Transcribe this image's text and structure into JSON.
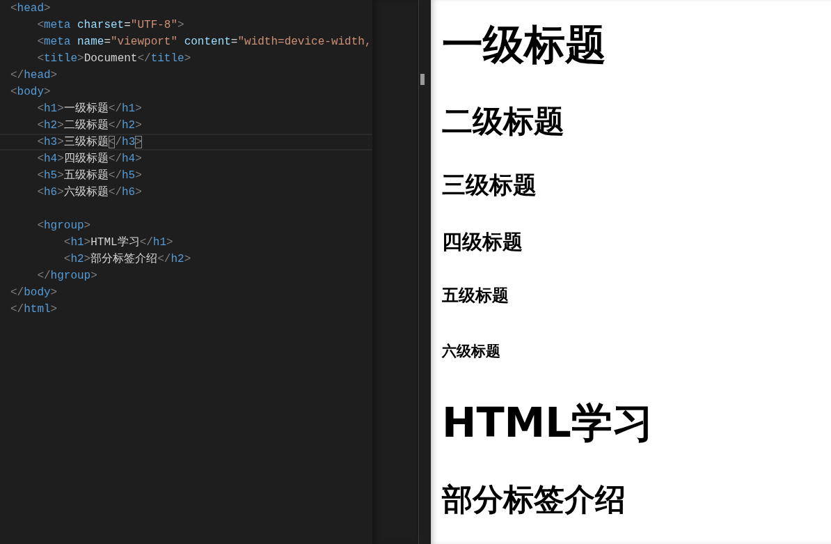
{
  "editor": {
    "lines": [
      {
        "selected": false,
        "tokens": [
          {
            "kind": "bracket",
            "text": "<"
          },
          {
            "kind": "tag",
            "text": "head"
          },
          {
            "kind": "bracket",
            "text": ">"
          }
        ],
        "children": [
          {
            "selected": false,
            "tokens": [
              {
                "kind": "bracket",
                "text": "<"
              },
              {
                "kind": "tag",
                "text": "meta"
              },
              {
                "kind": "attr",
                "text": "charset"
              },
              {
                "kind": "text",
                "text": "="
              },
              {
                "kind": "string",
                "text": "\"UTF-8\""
              },
              {
                "kind": "bracket",
                "text": ">"
              }
            ]
          },
          {
            "selected": false,
            "tokens": [
              {
                "kind": "bracket",
                "text": "<"
              },
              {
                "kind": "tag",
                "text": "meta"
              },
              {
                "kind": "attr",
                "text": "name"
              },
              {
                "kind": "text",
                "text": "="
              },
              {
                "kind": "string",
                "text": "\"viewport\""
              },
              {
                "kind": "attr",
                "text": "content"
              },
              {
                "kind": "text",
                "text": "="
              },
              {
                "kind": "string",
                "text": "\"width=device-width,"
              }
            ]
          },
          {
            "selected": false,
            "tokens": [
              {
                "kind": "bracket",
                "text": "<"
              },
              {
                "kind": "tag",
                "text": "title"
              },
              {
                "kind": "bracket",
                "text": ">"
              },
              {
                "kind": "text",
                "text": "Document"
              },
              {
                "kind": "bracket",
                "text": "</"
              },
              {
                "kind": "tag",
                "text": "title"
              },
              {
                "kind": "bracket",
                "text": ">"
              }
            ]
          }
        ]
      },
      {
        "selected": false,
        "tokens": [
          {
            "kind": "bracket",
            "text": "</"
          },
          {
            "kind": "tag",
            "text": "head"
          },
          {
            "kind": "bracket",
            "text": ">"
          }
        ]
      },
      {
        "selected": false,
        "tokens": [
          {
            "kind": "bracket",
            "text": "<"
          },
          {
            "kind": "tag",
            "text": "body"
          },
          {
            "kind": "bracket",
            "text": ">"
          }
        ],
        "children": [
          {
            "selected": false,
            "tokens": [
              {
                "kind": "bracket",
                "text": "<"
              },
              {
                "kind": "tag",
                "text": "h1"
              },
              {
                "kind": "bracket",
                "text": ">"
              },
              {
                "kind": "text",
                "text": "一级标题"
              },
              {
                "kind": "bracket",
                "text": "</"
              },
              {
                "kind": "tag",
                "text": "h1"
              },
              {
                "kind": "bracket",
                "text": ">"
              }
            ]
          },
          {
            "selected": false,
            "tokens": [
              {
                "kind": "bracket",
                "text": "<"
              },
              {
                "kind": "tag",
                "text": "h2"
              },
              {
                "kind": "bracket",
                "text": ">"
              },
              {
                "kind": "text",
                "text": "二级标题"
              },
              {
                "kind": "bracket",
                "text": "</"
              },
              {
                "kind": "tag",
                "text": "h2"
              },
              {
                "kind": "bracket",
                "text": ">"
              }
            ]
          },
          {
            "selected": true,
            "tokens": [
              {
                "kind": "bracket",
                "text": "<"
              },
              {
                "kind": "tag",
                "text": "h3"
              },
              {
                "kind": "bracket",
                "text": ">"
              },
              {
                "kind": "text",
                "text": "三级标题"
              },
              {
                "kind": "match",
                "text": "<"
              },
              {
                "kind": "bracket",
                "text": "/"
              },
              {
                "kind": "tag",
                "text": "h3"
              },
              {
                "kind": "match",
                "text": ">"
              }
            ]
          },
          {
            "selected": false,
            "tokens": [
              {
                "kind": "bracket",
                "text": "<"
              },
              {
                "kind": "tag",
                "text": "h4"
              },
              {
                "kind": "bracket",
                "text": ">"
              },
              {
                "kind": "text",
                "text": "四级标题"
              },
              {
                "kind": "bracket",
                "text": "</"
              },
              {
                "kind": "tag",
                "text": "h4"
              },
              {
                "kind": "bracket",
                "text": ">"
              }
            ]
          },
          {
            "selected": false,
            "tokens": [
              {
                "kind": "bracket",
                "text": "<"
              },
              {
                "kind": "tag",
                "text": "h5"
              },
              {
                "kind": "bracket",
                "text": ">"
              },
              {
                "kind": "text",
                "text": "五级标题"
              },
              {
                "kind": "bracket",
                "text": "</"
              },
              {
                "kind": "tag",
                "text": "h5"
              },
              {
                "kind": "bracket",
                "text": ">"
              }
            ]
          },
          {
            "selected": false,
            "tokens": [
              {
                "kind": "bracket",
                "text": "<"
              },
              {
                "kind": "tag",
                "text": "h6"
              },
              {
                "kind": "bracket",
                "text": ">"
              },
              {
                "kind": "text",
                "text": "六级标题"
              },
              {
                "kind": "bracket",
                "text": "</"
              },
              {
                "kind": "tag",
                "text": "h6"
              },
              {
                "kind": "bracket",
                "text": ">"
              }
            ]
          },
          {
            "selected": false
          },
          {
            "selected": false,
            "tokens": [
              {
                "kind": "bracket",
                "text": "<"
              },
              {
                "kind": "tag",
                "text": "hgroup"
              },
              {
                "kind": "bracket",
                "text": ">"
              }
            ],
            "children": [
              {
                "selected": false,
                "tokens": [
                  {
                    "kind": "bracket",
                    "text": "<"
                  },
                  {
                    "kind": "tag",
                    "text": "h1"
                  },
                  {
                    "kind": "bracket",
                    "text": ">"
                  },
                  {
                    "kind": "text",
                    "text": "HTML学习"
                  },
                  {
                    "kind": "bracket",
                    "text": "</"
                  },
                  {
                    "kind": "tag",
                    "text": "h1"
                  },
                  {
                    "kind": "bracket",
                    "text": ">"
                  }
                ]
              },
              {
                "selected": false,
                "tokens": [
                  {
                    "kind": "bracket",
                    "text": "<"
                  },
                  {
                    "kind": "tag",
                    "text": "h2"
                  },
                  {
                    "kind": "bracket",
                    "text": ">"
                  },
                  {
                    "kind": "text",
                    "text": "部分标签介绍"
                  },
                  {
                    "kind": "bracket",
                    "text": "</"
                  },
                  {
                    "kind": "tag",
                    "text": "h2"
                  },
                  {
                    "kind": "bracket",
                    "text": ">"
                  }
                ]
              }
            ]
          },
          {
            "selected": false,
            "tokens": [
              {
                "kind": "bracket",
                "text": "</"
              },
              {
                "kind": "tag",
                "text": "hgroup"
              },
              {
                "kind": "bracket",
                "text": ">"
              }
            ]
          }
        ]
      },
      {
        "selected": false,
        "tokens": [
          {
            "kind": "bracket",
            "text": "</"
          },
          {
            "kind": "tag",
            "text": "body"
          },
          {
            "kind": "bracket",
            "text": ">"
          }
        ]
      },
      {
        "selected": false,
        "tokens": [
          {
            "kind": "bracket",
            "text": "</"
          },
          {
            "kind": "tag",
            "text": "html"
          },
          {
            "kind": "bracket",
            "text": ">"
          }
        ]
      }
    ]
  },
  "preview": {
    "headings": [
      {
        "kind": "h1",
        "text": "一级标题"
      },
      {
        "kind": "h2",
        "text": "二级标题"
      },
      {
        "kind": "h3",
        "text": "三级标题"
      },
      {
        "kind": "h4",
        "text": "四级标题"
      },
      {
        "kind": "h5",
        "text": "五级标题"
      },
      {
        "kind": "h6",
        "text": "六级标题"
      },
      {
        "kind": "h1",
        "text": "HTML学习"
      },
      {
        "kind": "h2",
        "text": "部分标签介绍"
      }
    ]
  }
}
